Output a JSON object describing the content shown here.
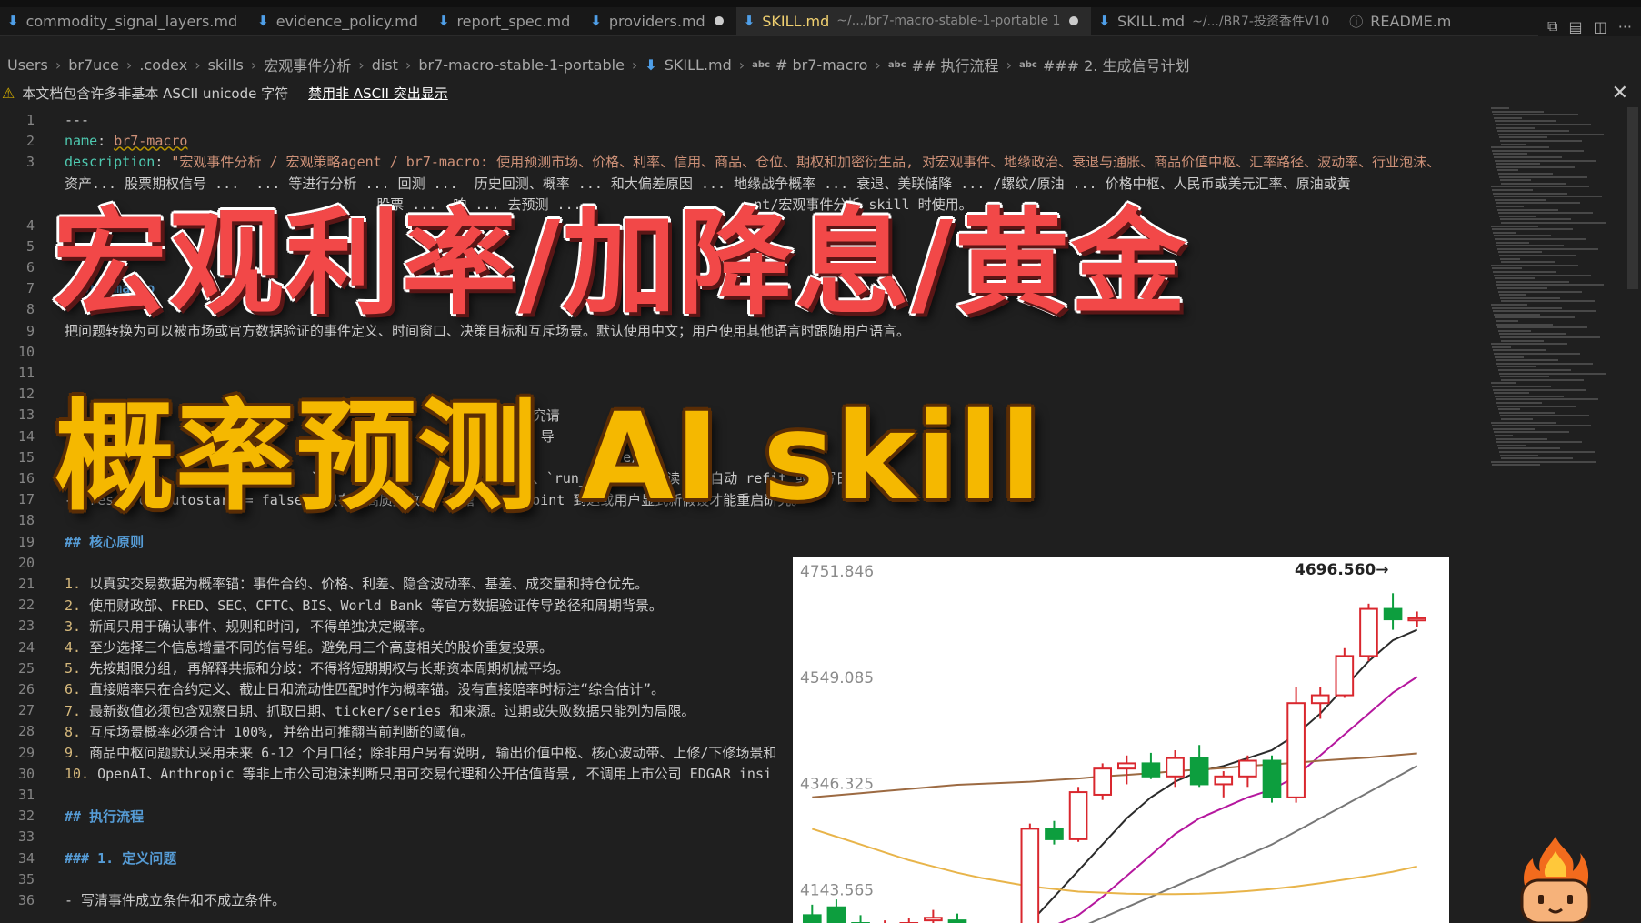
{
  "tabs": [
    {
      "label": "commodity_signal_layers.md",
      "active": false,
      "dirty": false
    },
    {
      "label": "evidence_policy.md",
      "active": false,
      "dirty": false
    },
    {
      "label": "report_spec.md",
      "active": false,
      "dirty": false
    },
    {
      "label": "providers.md",
      "active": false,
      "dirty": true
    },
    {
      "label": "SKILL.md",
      "path": "~/.../br7-macro-stable-1-portable 1",
      "active": true,
      "dirty": true
    },
    {
      "label": "SKILL.md",
      "path": "~/.../BR7-投资香件V10",
      "active": false,
      "dirty": false
    },
    {
      "label": "README.m",
      "active": false,
      "dirty": false,
      "info": true
    }
  ],
  "breadcrumb": [
    "Users",
    "br7uce",
    ".codex",
    "skills",
    "宏观事件分析",
    "dist",
    "br7-macro-stable-1-portable",
    "SKILL.md",
    "# br7-macro",
    "## 执行流程",
    "### 2. 生成信号计划"
  ],
  "breadcrumb_abc": "abc",
  "warning": {
    "text": "本文档包含许多非基本 ASCII unicode 字符",
    "link": "禁用非 ASCII 突出显示"
  },
  "lines": [
    {
      "n": "1",
      "text": "---"
    },
    {
      "n": "2",
      "key": "name",
      "val": "br7-macro"
    },
    {
      "n": "3",
      "key": "description",
      "val": "\"宏观事件分析 / 宏观策略agent / br7-macro: 使用预测市场、价格、利率、信用、商品、仓位、期权和加密衍生品, 对宏观事件、地缘政治、衰退与通胀、商品价值中枢、汇率路径、波动率、行业泡沫、"
    },
    {
      "n": "",
      "text": "资产... 股票期权信号 ...  ... 等进行分析 ... 回测 ...  历史回测、概率 ... 和大偏差原因 ... 地缘战争概率 ... 衰退、美联储降 ... /螺纹/原油 ... 价格中枢、人民币或美元汇率、原油或黄"
    },
    {
      "n": "",
      "text": "                                      股票 ...  响 ... 去预测 ...                     nt/宏观事件分析 skill 时使用。"
    },
    {
      "n": "4",
      "text": "m                       o"
    },
    {
      "n": "5",
      "text": ""
    },
    {
      "n": "6",
      "text": ""
    },
    {
      "n": "7",
      "head": "# br7-macro"
    },
    {
      "n": "8",
      "text": ""
    },
    {
      "n": "9",
      "text": "把问题转换为可以被市场或官方数据验证的事件定义、时间窗口、决策目标和互斥场景。默认使用中文；用户使用其他语言时跟随用户语言。"
    },
    {
      "n": "10",
      "text": ""
    },
    {
      "n": "11",
      "text": ""
    },
    {
      "n": "12",
      "text": ""
    },
    {
      "n": "13",
      "text": "                                                         究请"
    },
    {
      "n": "14",
      "text": "                                                          导                /ar"
    },
    {
      "n": "15",
      "text": "                                                                    e/      kit"
    },
    {
      "n": "16",
      "text": "    _produ        `  r        `               date_skill`、`run_shadow` 只读, 不自动 refit 或改写日志。"
    },
    {
      "n": "17",
      "text": "- `research_autostart = false`。只有新高质量数据、前瞻 checkpoint 到达或用户显式新假设才能重启研究。"
    },
    {
      "n": "18",
      "text": ""
    },
    {
      "n": "19",
      "head": "## 核心原则"
    },
    {
      "n": "20",
      "text": ""
    },
    {
      "n": "21",
      "num": "1.",
      "text": " 以真实交易数据为概率锚：事件合约、价格、利差、隐含波动率、基差、成交量和持仓优先。"
    },
    {
      "n": "22",
      "num": "2.",
      "text": " 使用财政部、FRED、SEC、CFTC、BIS、World Bank 等官方数据验证传导路径和周期背景。"
    },
    {
      "n": "23",
      "num": "3.",
      "text": " 新闻只用于确认事件、规则和时间, 不得单独决定概率。"
    },
    {
      "n": "24",
      "num": "4.",
      "text": " 至少选择三个信息增量不同的信号组。避免用三个高度相关的股价重复投票。"
    },
    {
      "n": "25",
      "num": "5.",
      "text": " 先按期限分组, 再解释共振和分歧：不得将短期期权与长期资本周期机械平均。"
    },
    {
      "n": "26",
      "num": "6.",
      "text": " 直接赔率只在合约定义、截止日和流动性匹配时作为概率锚。没有直接赔率时标注“综合估计”。"
    },
    {
      "n": "27",
      "num": "7.",
      "text": " 最新数值必须包含观察日期、抓取日期、ticker/series 和来源。过期或失败数据只能列为局限。"
    },
    {
      "n": "28",
      "num": "8.",
      "text": " 互斥场景概率必须合计 100%, 并给出可推翻当前判断的阈值。"
    },
    {
      "n": "29",
      "num": "9.",
      "text": " 商品中枢问题默认采用未来 6-12 个月口径；除非用户另有说明, 输出价值中枢、核心波动带、上修/下修场景和"
    },
    {
      "n": "30",
      "num": "10.",
      "text": " OpenAI、Anthropic 等非上市公司泡沫判断只用可交易代理和公开估值背景, 不调用上市公司 EDGAR insi"
    },
    {
      "n": "31",
      "text": ""
    },
    {
      "n": "32",
      "head": "## 执行流程"
    },
    {
      "n": "33",
      "text": ""
    },
    {
      "n": "34",
      "head": "### 1. 定义问题"
    },
    {
      "n": "35",
      "text": ""
    },
    {
      "n": "36",
      "text": "- 写清事件成立条件和不成立条件。"
    }
  ],
  "overlay": {
    "title1": "宏观利率/加降息/黄金",
    "title2": "概率预测 AI skill",
    "title1_color": "#f24848",
    "title2_color": "#f5b800"
  },
  "chart_data": {
    "type": "candlestick",
    "ylim": [
      4080,
      4780
    ],
    "y_ticks": [
      4751.846,
      4549.085,
      4346.325,
      4143.565
    ],
    "y_tick_labels": [
      "4751.846",
      "4549.085",
      "4346.325",
      "4143.565"
    ],
    "last_price_label": "4696.560→",
    "up_color": "#d9272e",
    "down_color": "#0d9e3e",
    "candles": [
      {
        "o": 4095,
        "h": 4115,
        "l": 4040,
        "c": 4060
      },
      {
        "o": 4110,
        "h": 4125,
        "l": 4050,
        "c": 4060
      },
      {
        "o": 4080,
        "h": 4095,
        "l": 4040,
        "c": 4050
      },
      {
        "o": 4060,
        "h": 4085,
        "l": 4035,
        "c": 4075
      },
      {
        "o": 4070,
        "h": 4090,
        "l": 4050,
        "c": 4080
      },
      {
        "o": 4085,
        "h": 4105,
        "l": 4065,
        "c": 4090
      },
      {
        "o": 4085,
        "h": 4098,
        "l": 4060,
        "c": 4070
      },
      {
        "o": 4065,
        "h": 4070,
        "l": 4030,
        "c": 4040
      },
      {
        "o": 4040,
        "h": 4060,
        "l": 4020,
        "c": 4050
      },
      {
        "o": 4050,
        "h": 4270,
        "l": 4040,
        "c": 4260
      },
      {
        "o": 4260,
        "h": 4275,
        "l": 4230,
        "c": 4240
      },
      {
        "o": 4240,
        "h": 4340,
        "l": 4235,
        "c": 4330
      },
      {
        "o": 4325,
        "h": 4385,
        "l": 4315,
        "c": 4375
      },
      {
        "o": 4375,
        "h": 4400,
        "l": 4345,
        "c": 4385
      },
      {
        "o": 4385,
        "h": 4405,
        "l": 4355,
        "c": 4360
      },
      {
        "o": 4360,
        "h": 4410,
        "l": 4340,
        "c": 4395
      },
      {
        "o": 4395,
        "h": 4420,
        "l": 4340,
        "c": 4345
      },
      {
        "o": 4345,
        "h": 4370,
        "l": 4320,
        "c": 4360
      },
      {
        "o": 4360,
        "h": 4400,
        "l": 4340,
        "c": 4390
      },
      {
        "o": 4390,
        "h": 4400,
        "l": 4310,
        "c": 4320
      },
      {
        "o": 4320,
        "h": 4530,
        "l": 4310,
        "c": 4500
      },
      {
        "o": 4500,
        "h": 4530,
        "l": 4470,
        "c": 4515
      },
      {
        "o": 4515,
        "h": 4605,
        "l": 4510,
        "c": 4590
      },
      {
        "o": 4590,
        "h": 4690,
        "l": 4580,
        "c": 4680
      },
      {
        "o": 4680,
        "h": 4710,
        "l": 4640,
        "c": 4660
      },
      {
        "o": 4658,
        "h": 4675,
        "l": 4645,
        "c": 4662
      }
    ],
    "ma_lines": [
      {
        "color": "#2b2b2b",
        "values": [
          null,
          null,
          null,
          null,
          null,
          null,
          null,
          null,
          null,
          4080,
          4130,
          4180,
          4230,
          4280,
          4320,
          4350,
          4370,
          4380,
          4395,
          4410,
          4440,
          4480,
          4530,
          4580,
          4620,
          4640
        ]
      },
      {
        "color": "#b5179e",
        "values": [
          null,
          null,
          null,
          null,
          null,
          null,
          null,
          null,
          null,
          4060,
          4075,
          4095,
          4130,
          4170,
          4210,
          4250,
          4280,
          4300,
          4320,
          4335,
          4360,
          4400,
          4440,
          4480,
          4520,
          4550
        ]
      },
      {
        "color": "#9c6a42",
        "values": [
          4320,
          4324,
          4328,
          4332,
          4336,
          4340,
          4344,
          4346,
          4348,
          4350,
          4353,
          4356,
          4360,
          4363,
          4366,
          4370,
          4373,
          4376,
          4380,
          4383,
          4386,
          4390,
          4393,
          4396,
          4400,
          4404
        ]
      },
      {
        "color": "#777777",
        "values": [
          null,
          null,
          null,
          null,
          null,
          null,
          null,
          null,
          null,
          4040,
          4055,
          4070,
          4090,
          4110,
          4130,
          4150,
          4170,
          4190,
          4210,
          4230,
          4255,
          4280,
          4305,
          4330,
          4355,
          4380
        ]
      },
      {
        "color": "#e8b44a",
        "values": [
          4260,
          4245,
          4230,
          4215,
          4200,
          4188,
          4176,
          4166,
          4158,
          4150,
          4145,
          4140,
          4138,
          4136,
          4135,
          4135,
          4136,
          4138,
          4141,
          4145,
          4150,
          4156,
          4163,
          4170,
          4178,
          4188
        ]
      }
    ]
  },
  "icons": {
    "md": "markdown-icon",
    "warn": "warning-icon",
    "close": "close-icon",
    "mascot": "fire-mascot-icon"
  }
}
